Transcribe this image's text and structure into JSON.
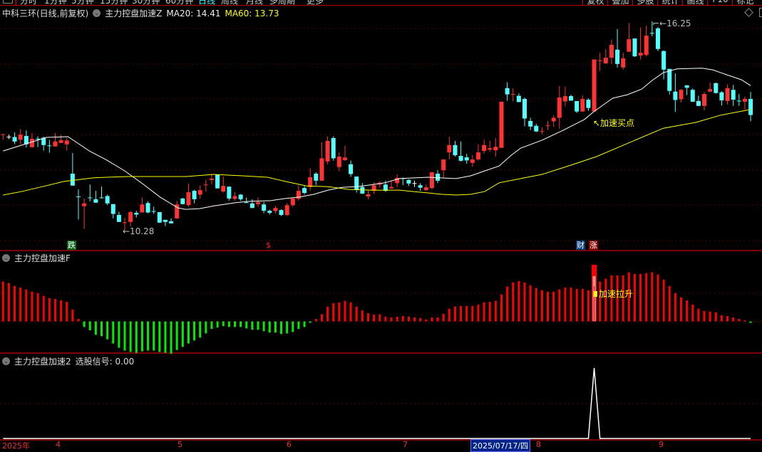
{
  "toolbar": {
    "tabs": [
      "分时",
      "1分钟",
      "5分钟",
      "15分钟",
      "30分钟",
      "60分钟",
      "日线",
      "周线",
      "月线",
      "多周期",
      "更多"
    ],
    "active_tab": "日线",
    "right_buttons": [
      "复权",
      "叠加",
      "多股",
      "统计",
      "画线",
      "F10",
      "标记"
    ]
  },
  "header": {
    "stock": "中科三环(日线,前复权)",
    "indicator": "主力控盘加速Z",
    "ma20_label": "MA20: 14.41",
    "ma60_label": "MA60: 13.73"
  },
  "colors": {
    "up": "#ff3333",
    "down": "#54ffff",
    "ma20": "#ffffff",
    "ma60": "#ffff00",
    "grid": "#a00000",
    "osc_up": "#ff0000",
    "osc_down": "#00ee00"
  },
  "annotations": {
    "low_label": "←10.28",
    "high_label": "16.25",
    "buy_point": "↖加速买点",
    "accel_label": "加速拉升",
    "tag_fall": "跌",
    "tag_dollar": "$",
    "tag_finance": "财",
    "tag_rise": "涨"
  },
  "panes": {
    "osc_title": "主力控盘加速F",
    "signal_title": "主力控盘加速2",
    "signal_label": "选股信号: 0.00"
  },
  "xaxis": {
    "labels": [
      "2025年",
      "4",
      "5",
      "6",
      "7",
      "8",
      "9"
    ],
    "cursor_date": "2025/07/17/四"
  },
  "chart_data": {
    "type": "candlestick",
    "price_range": [
      10.28,
      16.25
    ],
    "ohlc": [
      [
        13.01,
        13.03,
        12.86,
        13.02
      ],
      [
        12.95,
        13.01,
        12.88,
        12.95,
        "w"
      ],
      [
        12.94,
        13.07,
        12.74,
        12.81
      ],
      [
        12.86,
        13.17,
        12.72,
        13.01
      ],
      [
        12.97,
        13.13,
        12.64,
        12.73
      ],
      [
        12.65,
        13.05,
        12.63,
        12.89
      ],
      [
        12.89,
        12.96,
        12.65,
        12.89,
        "c"
      ],
      [
        12.92,
        12.95,
        12.55,
        12.71
      ],
      [
        12.7,
        12.86,
        12.49,
        12.7,
        "c"
      ],
      [
        12.67,
        13.05,
        12.67,
        12.81
      ],
      [
        12.77,
        13.0,
        12.77,
        12.85
      ],
      [
        12.73,
        12.91,
        12.55,
        12.84
      ],
      [
        11.89,
        12.48,
        11.55,
        11.55
      ],
      [
        11.24,
        11.44,
        10.58,
        11.24,
        "c"
      ],
      [
        10.96,
        11.18,
        10.31,
        11.04
      ],
      [
        11.21,
        11.58,
        11.1,
        11.21,
        "c"
      ],
      [
        11.16,
        11.4,
        11.06,
        11.06
      ],
      [
        11.21,
        11.52,
        11.18,
        11.21,
        "c"
      ],
      [
        11.25,
        11.29,
        10.99,
        11.04
      ],
      [
        11.02,
        11.02,
        10.61,
        10.74
      ],
      [
        10.71,
        10.8,
        10.51,
        10.51
      ],
      [
        10.5,
        10.63,
        10.28,
        10.5,
        "r"
      ],
      [
        10.51,
        10.83,
        10.38,
        10.79
      ],
      [
        10.77,
        10.83,
        10.64,
        10.72
      ],
      [
        10.78,
        11.21,
        10.78,
        11.01
      ],
      [
        11.05,
        11.1,
        10.76,
        10.78
      ],
      [
        10.82,
        10.95,
        10.74,
        10.82,
        "c"
      ],
      [
        10.79,
        10.79,
        10.48,
        10.49
      ],
      [
        10.57,
        10.57,
        10.39,
        10.51
      ],
      [
        10.53,
        10.61,
        10.46,
        10.47
      ],
      [
        10.61,
        11.11,
        10.6,
        11.01
      ],
      [
        11.18,
        11.2,
        11.01,
        11.02
      ],
      [
        10.99,
        11.6,
        10.94,
        11.36
      ],
      [
        11.4,
        11.43,
        11.04,
        11.16
      ],
      [
        11.29,
        11.55,
        11.18,
        11.42
      ],
      [
        11.58,
        11.72,
        11.38,
        11.58,
        "r"
      ],
      [
        11.71,
        11.89,
        11.58,
        11.75
      ],
      [
        11.86,
        11.86,
        11.47,
        11.47
      ],
      [
        11.38,
        11.81,
        11.35,
        11.54
      ],
      [
        11.52,
        11.52,
        11.12,
        11.18
      ],
      [
        11.17,
        11.36,
        11.12,
        11.25
      ],
      [
        11.29,
        11.31,
        11.11,
        11.16
      ],
      [
        11.07,
        11.21,
        11.06,
        11.07,
        "c"
      ],
      [
        11.04,
        11.16,
        10.9,
        10.91
      ],
      [
        11.02,
        11.21,
        10.94,
        11.08
      ],
      [
        11.01,
        11.08,
        10.76,
        10.83
      ],
      [
        10.83,
        10.86,
        10.72,
        10.77
      ],
      [
        10.82,
        10.97,
        10.75,
        10.91
      ],
      [
        10.85,
        10.87,
        10.68,
        10.71
      ],
      [
        10.71,
        11.05,
        10.68,
        10.99
      ],
      [
        10.99,
        11.21,
        10.94,
        11.18
      ],
      [
        11.17,
        11.56,
        11.12,
        11.4
      ],
      [
        11.48,
        11.54,
        11.29,
        11.34
      ],
      [
        11.51,
        12.05,
        11.4,
        11.79
      ],
      [
        11.89,
        11.93,
        11.56,
        11.69
      ],
      [
        11.69,
        12.79,
        11.69,
        12.33
      ],
      [
        12.24,
        12.96,
        12.16,
        12.83
      ],
      [
        12.91,
        12.96,
        12.26,
        12.33
      ],
      [
        12.08,
        12.5,
        11.96,
        12.38
      ],
      [
        12.28,
        12.69,
        12.26,
        12.35
      ],
      [
        12.16,
        12.27,
        11.8,
        11.88
      ],
      [
        11.81,
        11.81,
        11.35,
        11.43
      ],
      [
        11.51,
        11.62,
        11.31,
        11.32
      ],
      [
        11.24,
        11.41,
        11.16,
        11.3
      ],
      [
        11.4,
        11.65,
        11.31,
        11.56
      ],
      [
        11.58,
        11.67,
        11.48,
        11.63
      ],
      [
        11.58,
        11.69,
        11.37,
        11.4
      ],
      [
        11.47,
        11.69,
        11.47,
        11.51
      ],
      [
        11.62,
        11.87,
        11.51,
        11.77
      ],
      [
        11.76,
        11.78,
        11.56,
        11.76,
        "c"
      ],
      [
        11.71,
        11.73,
        11.54,
        11.61
      ],
      [
        11.62,
        11.69,
        11.51,
        11.62,
        "w"
      ],
      [
        11.56,
        11.62,
        11.4,
        11.49
      ],
      [
        11.42,
        11.58,
        11.4,
        11.5
      ],
      [
        11.48,
        11.94,
        11.44,
        11.93
      ],
      [
        11.89,
        11.99,
        11.62,
        11.69
      ],
      [
        11.99,
        12.3,
        11.77,
        12.3
      ],
      [
        12.5,
        12.95,
        12.3,
        12.71
      ],
      [
        12.71,
        12.83,
        12.38,
        12.42
      ],
      [
        12.4,
        12.81,
        12.24,
        12.26
      ],
      [
        12.36,
        12.46,
        12.18,
        12.27
      ],
      [
        12.2,
        12.42,
        12.09,
        12.3
      ],
      [
        12.3,
        12.73,
        12.26,
        12.5
      ],
      [
        12.54,
        12.87,
        12.46,
        12.71
      ],
      [
        12.58,
        12.83,
        12.52,
        12.62
      ],
      [
        12.56,
        12.91,
        12.38,
        12.66
      ],
      [
        12.63,
        13.95,
        12.63,
        13.95
      ],
      [
        14.34,
        14.51,
        13.98,
        14.16
      ],
      [
        14.17,
        14.34,
        13.96,
        14.17,
        "r"
      ],
      [
        14.12,
        14.19,
        13.94,
        13.94
      ],
      [
        14.03,
        14.07,
        13.25,
        13.47
      ],
      [
        13.4,
        13.49,
        13.14,
        13.24
      ],
      [
        13.26,
        13.32,
        13.08,
        13.1
      ],
      [
        13.11,
        13.22,
        13.02,
        13.11,
        "r"
      ],
      [
        13.28,
        13.4,
        13.14,
        13.28,
        "r"
      ],
      [
        13.39,
        13.56,
        13.23,
        13.49
      ],
      [
        13.49,
        14.4,
        13.18,
        14.07
      ],
      [
        13.96,
        14.38,
        13.82,
        14.11
      ],
      [
        14.11,
        14.15,
        13.98,
        13.98
      ],
      [
        13.97,
        13.97,
        13.63,
        13.67
      ],
      [
        13.67,
        14.13,
        13.66,
        14.03
      ],
      [
        14.01,
        14.05,
        13.69,
        13.77
      ],
      [
        13.67,
        15.16,
        13.67,
        15.16
      ],
      [
        15.13,
        15.35,
        14.83,
        15.13,
        "r"
      ],
      [
        15.05,
        15.46,
        15.03,
        15.21
      ],
      [
        15.21,
        15.73,
        15.03,
        15.58
      ],
      [
        15.44,
        16.03,
        14.93,
        15.03
      ],
      [
        14.93,
        15.35,
        14.87,
        15.19
      ],
      [
        15.38,
        16.2,
        15.38,
        15.74
      ],
      [
        15.76,
        15.76,
        15.23,
        15.25
      ],
      [
        15.27,
        16.07,
        15.16,
        15.35
      ],
      [
        15.29,
        16.13,
        15.25,
        15.84
      ],
      [
        15.92,
        16.25,
        15.82,
        15.92,
        "c"
      ],
      [
        16.05,
        16.09,
        15.4,
        15.46
      ],
      [
        15.4,
        15.42,
        14.59,
        14.87
      ],
      [
        14.89,
        14.89,
        14.16,
        14.26
      ],
      [
        14.24,
        14.76,
        13.66,
        14.0
      ],
      [
        14.02,
        14.31,
        13.93,
        14.29
      ],
      [
        14.42,
        14.42,
        14.14,
        14.35
      ],
      [
        14.29,
        14.33,
        13.95,
        13.95
      ],
      [
        13.97,
        14.12,
        13.83,
        13.83
      ],
      [
        13.83,
        14.23,
        13.7,
        14.17
      ],
      [
        14.24,
        14.5,
        14.22,
        14.31
      ],
      [
        14.48,
        14.5,
        14.18,
        14.2
      ],
      [
        14.22,
        14.25,
        13.84,
        13.99
      ],
      [
        13.97,
        14.45,
        13.87,
        14.34
      ],
      [
        14.29,
        14.43,
        13.83,
        14.01
      ],
      [
        13.98,
        14.17,
        13.83,
        13.98,
        "c"
      ],
      [
        13.95,
        14.1,
        13.72,
        14.03
      ],
      [
        14.03,
        14.23,
        13.39,
        13.57
      ]
    ],
    "ma20": [
      [
        0,
        12.54
      ],
      [
        7.5,
        12.93
      ],
      [
        11.2,
        12.95
      ],
      [
        14.9,
        12.54
      ],
      [
        17.9,
        12.28
      ],
      [
        21,
        11.97
      ],
      [
        24.1,
        11.6
      ],
      [
        27.1,
        11.22
      ],
      [
        30.2,
        10.91
      ],
      [
        31.5,
        10.87
      ],
      [
        33.9,
        10.89
      ],
      [
        36.4,
        10.97
      ],
      [
        40.1,
        11.06
      ],
      [
        42.5,
        11.1
      ],
      [
        46.2,
        11.12
      ],
      [
        48.7,
        11.18
      ],
      [
        51.1,
        11.22
      ],
      [
        53.6,
        11.3
      ],
      [
        56.1,
        11.42
      ],
      [
        58.5,
        11.5
      ],
      [
        61,
        11.52
      ],
      [
        63.4,
        11.57
      ],
      [
        65.9,
        11.63
      ],
      [
        68.4,
        11.75
      ],
      [
        73.3,
        11.79
      ],
      [
        78.2,
        11.75
      ],
      [
        80.7,
        11.83
      ],
      [
        83.1,
        11.97
      ],
      [
        85.6,
        12.11
      ],
      [
        87.7,
        12.42
      ],
      [
        89.3,
        12.62
      ],
      [
        93,
        12.85
      ],
      [
        96.6,
        13.13
      ],
      [
        100.3,
        13.44
      ],
      [
        101.9,
        13.66
      ],
      [
        104,
        13.91
      ],
      [
        105.2,
        14.05
      ],
      [
        107.7,
        14.15
      ],
      [
        110.2,
        14.31
      ],
      [
        112,
        14.56
      ],
      [
        113.9,
        14.78
      ],
      [
        116.3,
        14.89
      ],
      [
        120.6,
        14.91
      ],
      [
        122.5,
        14.86
      ],
      [
        124.9,
        14.72
      ],
      [
        127.4,
        14.58
      ],
      [
        129,
        14.41
      ]
    ],
    "ma60": [
      [
        0,
        11.28
      ],
      [
        3.2,
        11.38
      ],
      [
        6.8,
        11.52
      ],
      [
        10.5,
        11.67
      ],
      [
        15.5,
        11.77
      ],
      [
        17.9,
        11.79
      ],
      [
        21.6,
        11.81
      ],
      [
        31.6,
        11.81
      ],
      [
        36.4,
        11.87
      ],
      [
        41.3,
        11.83
      ],
      [
        45.6,
        11.79
      ],
      [
        48.7,
        11.67
      ],
      [
        52.4,
        11.54
      ],
      [
        56.1,
        11.52
      ],
      [
        59.7,
        11.44
      ],
      [
        63.4,
        11.42
      ],
      [
        68.4,
        11.42
      ],
      [
        70.8,
        11.38
      ],
      [
        73.3,
        11.34
      ],
      [
        75.7,
        11.3
      ],
      [
        78.2,
        11.28
      ],
      [
        80.7,
        11.3
      ],
      [
        83.1,
        11.38
      ],
      [
        85.6,
        11.63
      ],
      [
        93,
        11.87
      ],
      [
        97.9,
        12.13
      ],
      [
        102.4,
        12.38
      ],
      [
        113.9,
        13.19
      ],
      [
        119.6,
        13.36
      ],
      [
        123.7,
        13.56
      ],
      [
        129,
        13.73
      ]
    ],
    "oscillator": [
      14.2,
      13.7,
      12.6,
      12.1,
      11.4,
      10.6,
      10.1,
      9.1,
      8.3,
      8.0,
      7.5,
      7.0,
      4.2,
      0.9,
      -2.0,
      -3.2,
      -4.8,
      -5.3,
      -6.4,
      -7.9,
      -9.4,
      -10.4,
      -10.9,
      -11.2,
      -10.7,
      -10.4,
      -10.4,
      -10.9,
      -11.2,
      -11.5,
      -10.2,
      -9.1,
      -7.9,
      -6.8,
      -5.8,
      -4.3,
      -2.7,
      -2.2,
      -1.7,
      -2.0,
      -2.0,
      -2.0,
      -2.5,
      -3.0,
      -3.0,
      -3.5,
      -4.0,
      -4.0,
      -4.5,
      -4.3,
      -3.8,
      -2.7,
      -2.0,
      -0.4,
      0.9,
      2.6,
      5.2,
      6.5,
      6.8,
      7.3,
      6.8,
      5.2,
      3.9,
      2.9,
      2.4,
      2.5,
      1.7,
      1.4,
      1.7,
      1.9,
      1.7,
      1.4,
      1.2,
      0.7,
      1.4,
      1.4,
      2.7,
      4.5,
      5.3,
      5.5,
      5.5,
      5.5,
      6.0,
      6.8,
      7.0,
      7.3,
      9.6,
      12.4,
      13.9,
      14.4,
      13.9,
      12.9,
      11.9,
      11.1,
      10.6,
      10.6,
      11.4,
      12.1,
      12.1,
      11.6,
      11.6,
      11.1,
      20.2,
      14.2,
      15.2,
      16.4,
      16.4,
      16.4,
      17.5,
      16.9,
      16.9,
      17.2,
      17.5,
      16.7,
      14.9,
      12.6,
      10.1,
      8.6,
      7.5,
      6.0,
      4.5,
      3.7,
      3.5,
      3.2,
      2.2,
      1.9,
      1.4,
      0.9,
      0.4,
      -0.3
    ],
    "accel_bar": 102,
    "signal_triggers": [
      102
    ],
    "signal_range": [
      0,
      1
    ]
  }
}
